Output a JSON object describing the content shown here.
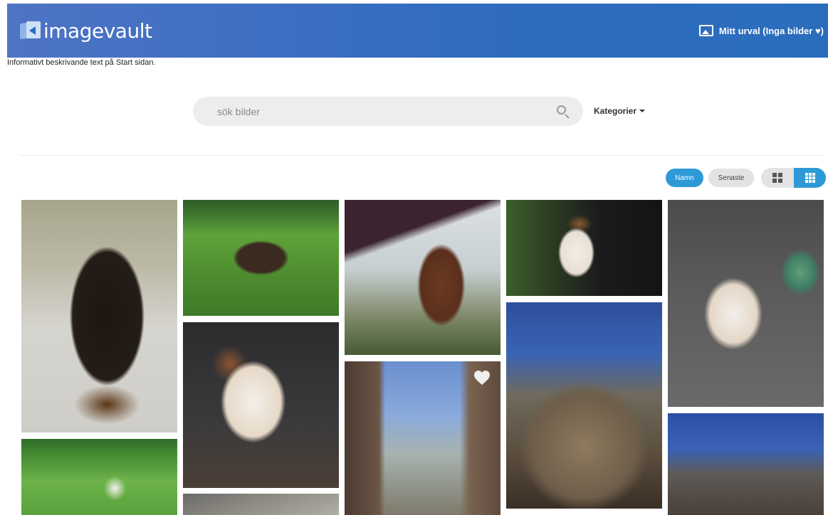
{
  "header": {
    "logo_text": "imagevault",
    "selection_label": "Mitt urval (Inga bilder ♥)"
  },
  "intro_text": "Informativt beskrivande text på Start sidan.",
  "search": {
    "placeholder": "sök bilder",
    "value": ""
  },
  "categories_label": "Kategorier",
  "sort": {
    "name_label": "Namn",
    "latest_label": "Senaste",
    "active": "Namn"
  },
  "view": {
    "active": "small-grid"
  },
  "gallery": [
    {
      "subject": "doberman dog"
    },
    {
      "subject": "foal lying on grass"
    },
    {
      "subject": "foal sniffing hand"
    },
    {
      "subject": "puppy held in hands"
    },
    {
      "subject": "puppy lying on sofa"
    },
    {
      "subject": "puppy sitting"
    },
    {
      "subject": "roman ruins with column",
      "favorite_icon": "heart-icon"
    },
    {
      "subject": "colosseum at dusk"
    },
    {
      "subject": "two puppies on lawn"
    },
    {
      "subject": "stone ruins"
    },
    {
      "subject": "colosseum at dusk"
    }
  ],
  "colors": {
    "header_gradient_start": "#4e74c4",
    "header_gradient_end": "#2a6dbd",
    "accent": "#2d9ad6",
    "button_inactive": "#e3e3e3",
    "search_bg": "#ededed"
  }
}
